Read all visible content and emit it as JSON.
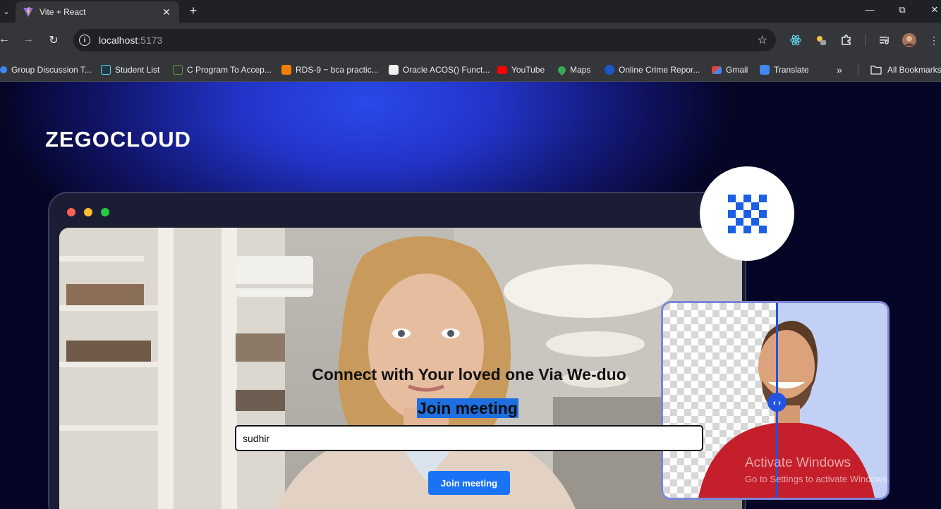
{
  "browser": {
    "tab": {
      "title": "Vite + React",
      "favicon": "vite-icon"
    },
    "address": {
      "host": "localhost",
      "port": ":5173"
    },
    "bookmarks": [
      {
        "label": "Group Discussion T...",
        "icon": "google-icon",
        "color": "#4285f4"
      },
      {
        "label": "Student List",
        "icon": "react-icon",
        "color": "#61dafb"
      },
      {
        "label": "C Program To Accep...",
        "icon": "code-icon",
        "color": "#5a9e3a"
      },
      {
        "label": "RDS-9 ~ bca practic...",
        "icon": "blogger-icon",
        "color": "#f57d00"
      },
      {
        "label": "Oracle ACOS() Funct...",
        "icon": "w3-icon",
        "color": "#e8eaed"
      },
      {
        "label": "YouTube",
        "icon": "youtube-icon",
        "color": "#ff0000"
      },
      {
        "label": "Maps",
        "icon": "maps-pin-icon",
        "color": "#34a853"
      },
      {
        "label": "Online Crime Repor...",
        "icon": "emblem-icon",
        "color": "#1a57c9"
      },
      {
        "label": "Gmail",
        "icon": "gmail-icon",
        "color": "#ea4335"
      },
      {
        "label": "Translate",
        "icon": "translate-icon",
        "color": "#4285f4"
      }
    ],
    "all_bookmarks": "All Bookmarks"
  },
  "page": {
    "logo": "ZEGOCLOUD",
    "headline": "Connect with Your loved one Via We-duo",
    "join_heading": "Join meeting",
    "name_input_value": "sudhir",
    "join_button": "Join meeting"
  },
  "watermark": {
    "line1": "Activate Windows",
    "line2": "Go to Settings to activate Windows."
  },
  "colors": {
    "accent": "#1a73f5",
    "page_background": "#050526",
    "glow": "#2a49e8"
  }
}
